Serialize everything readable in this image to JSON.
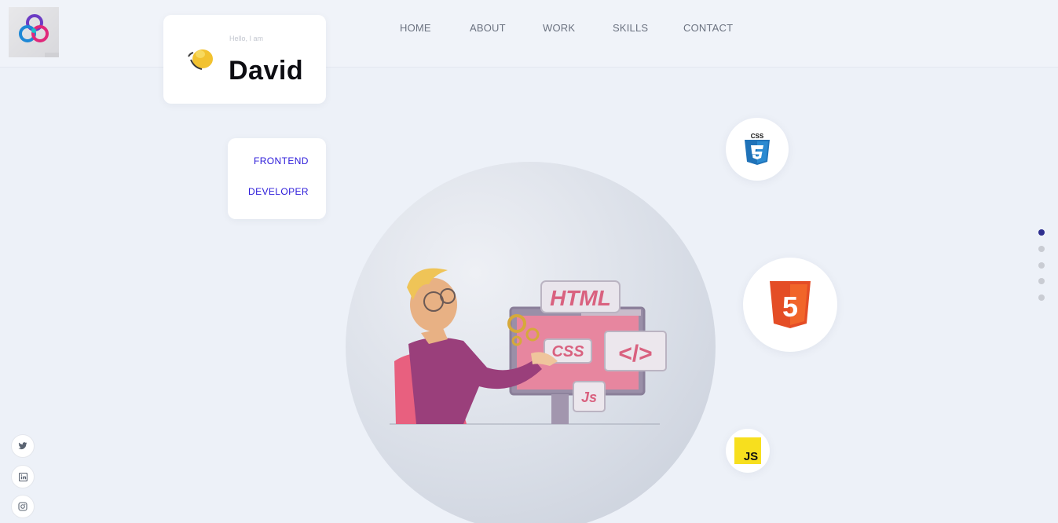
{
  "nav": {
    "home": "HOME",
    "about": "ABOUT",
    "work": "WORK",
    "skills": "SKILLS",
    "contact": "CONTACT"
  },
  "hero": {
    "greeting": "Hello, I am",
    "name": "David",
    "role_line1": "FRONTEND",
    "role_line2": "DEVELOPER"
  },
  "illustration": {
    "labels": {
      "html": "HTML",
      "css": "CSS",
      "code": "</>",
      "js": "Js"
    }
  },
  "skills_badges": [
    {
      "icon": "css3-icon",
      "text": "CSS"
    },
    {
      "icon": "html5-icon",
      "text": "5"
    },
    {
      "icon": "javascript-icon",
      "text": "JS"
    }
  ],
  "page_dots": {
    "count": 5,
    "active_index": 0
  },
  "social": [
    "twitter-icon",
    "linkedin-icon",
    "instagram-icon"
  ],
  "colors": {
    "accent": "#2b1ad9",
    "background": "#edf1f8",
    "dot_active": "#2e2f8f",
    "css_blue": "#1f72b8",
    "html_orange": "#e44d26",
    "js_yellow": "#f7df1e"
  }
}
